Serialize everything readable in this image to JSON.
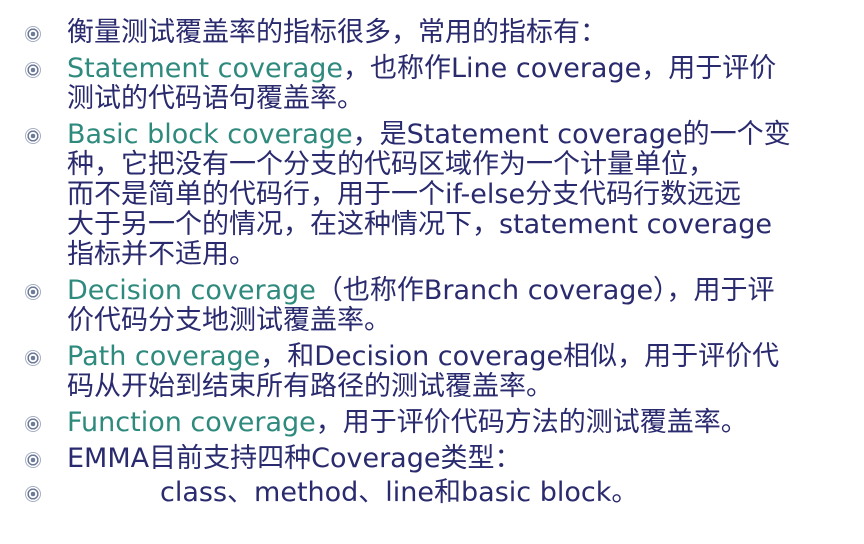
{
  "bullets": [
    {
      "lines": [
        "衡量测试覆盖率的指标很多，常用的指标有："
      ]
    },
    {
      "term": "Statement coverage",
      "lines": [
        "，也称作Line coverage，用于评价",
        "测试的代码语句覆盖率。"
      ]
    },
    {
      "term": "Basic block coverage",
      "lines": [
        "，是Statement coverage的一个变",
        "种，它把没有一个分支的代码区域作为一个计量单位，",
        "而不是简单的代码行，用于一个if-else分支代码行数远远",
        "大于另一个的情况，在这种情况下，statement coverage",
        "指标并不适用。"
      ]
    },
    {
      "term": "Decision coverage",
      "lines": [
        "（也称作Branch coverage），用于评",
        "价代码分支地测试覆盖率。"
      ]
    },
    {
      "term": "Path coverage",
      "lines": [
        "，和Decision coverage相似，用于评价代",
        "码从开始到结束所有路径的测试覆盖率。"
      ]
    },
    {
      "term": "Function coverage",
      "lines": [
        "，用于评价代码方法的测试覆盖率。"
      ]
    },
    {
      "lines": [
        "EMMA目前支持四种Coverage类型："
      ]
    },
    {
      "lines": [
        "class、method、line和basic block。"
      ]
    }
  ],
  "colors": {
    "text": "#2a2a6e",
    "term": "#2f8a7e"
  },
  "icons": {
    "bullet": "round-bullet-icon"
  }
}
